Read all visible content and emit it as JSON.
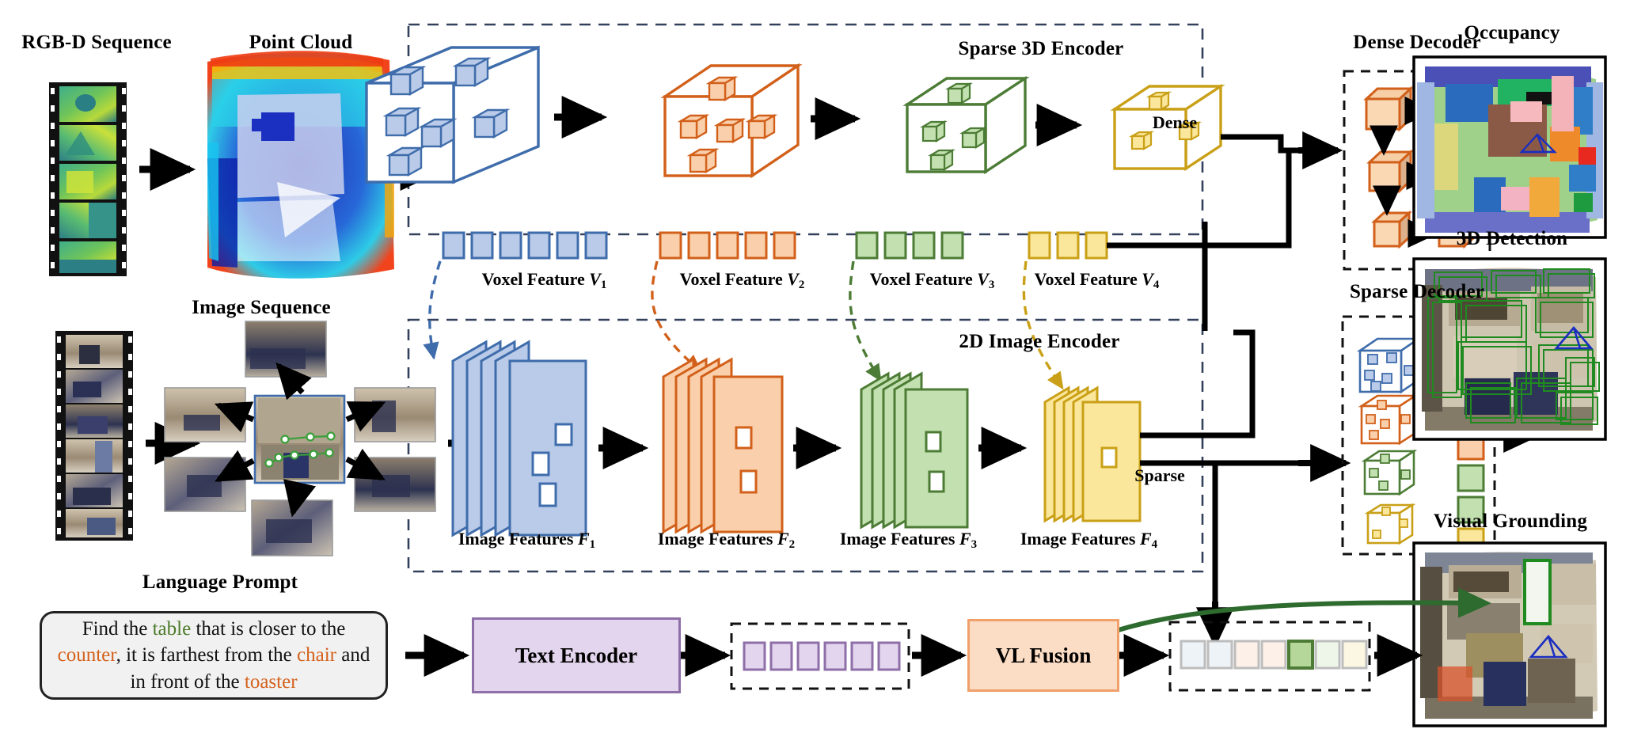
{
  "figure": {
    "kind": "model-architecture-diagram",
    "topic": "3D scene understanding pipeline with sparse 3D encoder, 2D image encoder, dense/sparse decoders and vision-language fusion"
  },
  "inputs": {
    "rgbd_sequence_label": "RGB-D Sequence",
    "point_cloud_label": "Point Cloud",
    "image_sequence_label": "Image Sequence",
    "language_prompt_label": "Language Prompt"
  },
  "prompt": {
    "segments": [
      {
        "text": "Find the ",
        "color": "#111111"
      },
      {
        "text": "table",
        "color": "#4d7a2a"
      },
      {
        "text": " that is closer to the ",
        "color": "#111111"
      },
      {
        "text": "counter",
        "color": "#d4611c"
      },
      {
        "text": ", it is farthest from the ",
        "color": "#111111"
      },
      {
        "text": "chair",
        "color": "#d4611c"
      },
      {
        "text": " and in front of the ",
        "color": "#111111"
      },
      {
        "text": "toaster",
        "color": "#d4611c"
      }
    ],
    "plain": "Find the table that is closer to the counter, it is farthest from the chair and in front of the toaster"
  },
  "encoders": {
    "sparse3d": {
      "title": "Sparse 3D Encoder",
      "stages": [
        {
          "label_prefix": "Voxel Feature ",
          "symbol": "V",
          "index": "1",
          "color": "#3f6cab",
          "fill": "#b9cbe8",
          "cubes": 6,
          "tokens": 6
        },
        {
          "label_prefix": "Voxel Feature ",
          "symbol": "V",
          "index": "2",
          "color": "#d2601a",
          "fill": "#fad0ac",
          "cubes": 5,
          "tokens": 5
        },
        {
          "label_prefix": "Voxel Feature ",
          "symbol": "V",
          "index": "3",
          "color": "#4c7c35",
          "fill": "#c3e0b0",
          "cubes": 4,
          "tokens": 4
        },
        {
          "label_prefix": "Voxel Feature ",
          "symbol": "V",
          "index": "4",
          "color": "#c9a017",
          "fill": "#fbe79b",
          "cubes": 3,
          "tokens": 3
        }
      ]
    },
    "image2d": {
      "title": "2D  Image Encoder",
      "stages": [
        {
          "label_prefix": "Image Features ",
          "symbol": "F",
          "index": "1",
          "color": "#3f6cab",
          "fill": "#b9cbe8",
          "planes": 5,
          "holes": 3
        },
        {
          "label_prefix": "Image Features ",
          "symbol": "F",
          "index": "2",
          "color": "#d2601a",
          "fill": "#fad0ac",
          "planes": 5,
          "holes": 2
        },
        {
          "label_prefix": "Image Features ",
          "symbol": "F",
          "index": "3",
          "color": "#4c7c35",
          "fill": "#c3e0b0",
          "planes": 5,
          "holes": 2
        },
        {
          "label_prefix": "Image Features ",
          "symbol": "F",
          "index": "4",
          "color": "#c9a017",
          "fill": "#fbe79b",
          "planes": 5,
          "holes": 1
        }
      ]
    }
  },
  "routes": {
    "dense_label": "Dense",
    "sparse_label": "Sparse"
  },
  "decoders": {
    "dense": {
      "title": "Dense Decoder",
      "cube_color": "#d2601a",
      "cube_fill": "#fad0ac",
      "cube_count": 6,
      "layout": "3-level U-shape, left column downward, right column upward"
    },
    "sparse": {
      "title": "Sparse Decoder",
      "cubes": [
        {
          "color": "#3f6cab",
          "fill": "#b9cbe8",
          "inner_cubes": 6
        },
        {
          "color": "#d2601a",
          "fill": "#fad0ac",
          "inner_cubes": 5
        },
        {
          "color": "#4c7c35",
          "fill": "#c3e0b0",
          "inner_cubes": 4
        },
        {
          "color": "#c9a017",
          "fill": "#fbe79b",
          "inner_cubes": 3
        }
      ],
      "query_tokens": [
        {
          "color": "#3f6cab",
          "fill": "#b9cbe8"
        },
        {
          "color": "#3f6cab",
          "fill": "#b9cbe8"
        },
        {
          "color": "#d2601a",
          "fill": "#fad0ac"
        },
        {
          "color": "#d2601a",
          "fill": "#fad0ac"
        },
        {
          "color": "#4c7c35",
          "fill": "#c3e0b0"
        },
        {
          "color": "#4c7c35",
          "fill": "#c3e0b0"
        },
        {
          "color": "#c9a017",
          "fill": "#fbe79b"
        }
      ]
    }
  },
  "language_branch": {
    "text_encoder_label": "Text Encoder",
    "text_encoder_color": "#8e6fa8",
    "text_encoder_fill": "#e3d5ed",
    "text_tokens": {
      "count": 6,
      "color": "#8e6fa8",
      "fill": "#e3d5ed"
    },
    "vl_fusion_label": "VL Fusion",
    "vl_fusion_color": "#f0a06a",
    "vl_fusion_fill": "#fbdcc5",
    "fused_tokens": [
      {
        "fill": "#eef3f7",
        "color": "#bdbdbd",
        "selected": false
      },
      {
        "fill": "#eef3f7",
        "color": "#bdbdbd",
        "selected": false
      },
      {
        "fill": "#fdf0e8",
        "color": "#bdbdbd",
        "selected": false
      },
      {
        "fill": "#fdf0e8",
        "color": "#bdbdbd",
        "selected": false
      },
      {
        "fill": "#b6d79a",
        "color": "#4c7c35",
        "selected": true
      },
      {
        "fill": "#eef6ea",
        "color": "#bdbdbd",
        "selected": false
      },
      {
        "fill": "#fcf7e2",
        "color": "#bdbdbd",
        "selected": false
      }
    ]
  },
  "outputs": [
    {
      "title": "Occupancy",
      "kind": "semantic-occupancy-map",
      "overlay": "blue camera frustum"
    },
    {
      "title": "3D Detection",
      "kind": "point-cloud-scene",
      "overlay": "green 3D bounding boxes + blue camera frustum"
    },
    {
      "title": "Visual Grounding",
      "kind": "point-cloud-scene",
      "overlay": "single green target box + blue camera frustum, green pointer arrow"
    }
  ],
  "palette": {
    "blue": "#3f6cab",
    "orange": "#d2601a",
    "green": "#4c7c35",
    "yellow": "#c9a017",
    "purple": "#8e6fa8",
    "peach": "#f0a06a",
    "dash_navy": "#33415c",
    "black": "#000000"
  }
}
